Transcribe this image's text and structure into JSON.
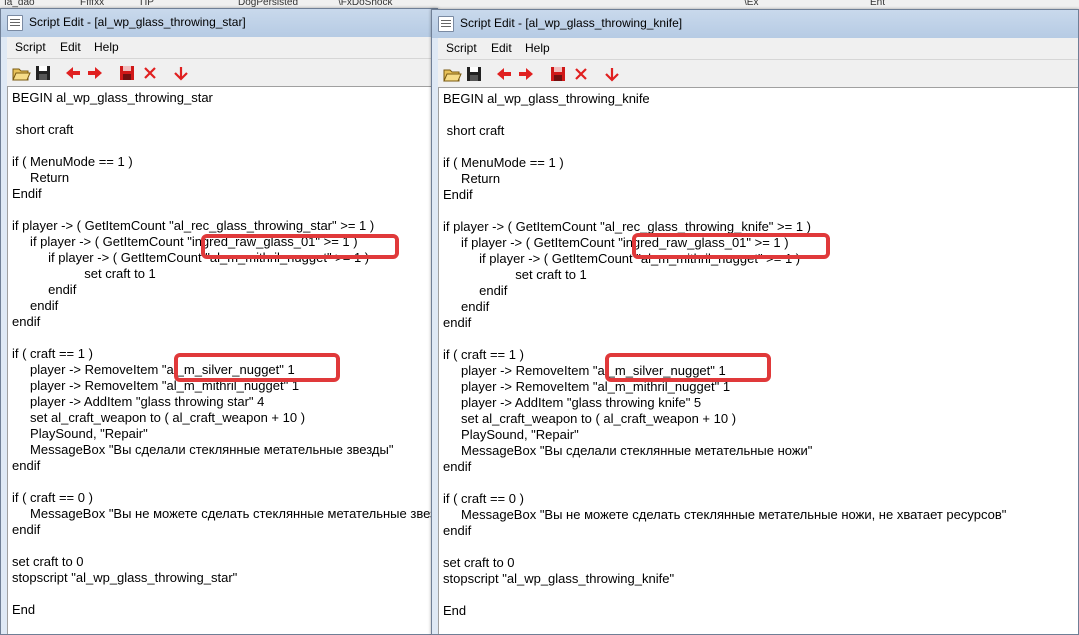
{
  "background": {
    "fragments": [
      "Ia_dao",
      "Ffffxx",
      "ПР",
      "DogPersisted",
      "\\FxDoShock",
      "\\Ex",
      "Ent"
    ]
  },
  "windows": [
    {
      "title": "Script Edit - [al_wp_glass_throwing_star]",
      "menu": [
        "Script",
        "Edit",
        "Help"
      ],
      "toolbar": [
        "open-folder-icon",
        "save-icon",
        "arrow-left-icon",
        "arrow-right-icon",
        "save-red-icon",
        "close-x-icon",
        "arrow-down-icon"
      ],
      "lines": [
        "BEGIN al_wp_glass_throwing_star",
        "",
        " short craft",
        "",
        "if ( MenuMode == 1 )",
        "     Return",
        "Endif",
        "",
        "if player -> ( GetItemCount \"al_rec_glass_throwing_star\" >= 1 )",
        "     if player -> ( GetItemCount \"ingred_raw_glass_01\" >= 1 )",
        "          if player -> ( GetItemCount \"al_m_mithril_nugget\" >= 1 )",
        "                    set craft to 1",
        "          endif",
        "     endif",
        "endif",
        "",
        "if ( craft == 1 )",
        "     player -> RemoveItem \"al_m_silver_nugget\" 1",
        "     player -> RemoveItem \"al_m_mithril_nugget\" 1",
        "     player -> AddItem \"glass throwing star\" 4",
        "     set al_craft_weapon to ( al_craft_weapon + 10 )",
        "     PlaySound, \"Repair\"",
        "     MessageBox \"Вы сделали стеклянные метательные звезды\"",
        "endif",
        "",
        "if ( craft == 0 )",
        "     MessageBox \"Вы не можете сделать стеклянные метательные звезды, не хватает ресурсов\"",
        "endif",
        "",
        "set craft to 0",
        "stopscript \"al_wp_glass_throwing_star\"",
        "",
        "End"
      ]
    },
    {
      "title": "Script Edit - [al_wp_glass_throwing_knife]",
      "menu": [
        "Script",
        "Edit",
        "Help"
      ],
      "toolbar": [
        "open-folder-icon",
        "save-icon",
        "arrow-left-icon",
        "arrow-right-icon",
        "save-red-icon",
        "close-x-icon",
        "arrow-down-icon"
      ],
      "lines": [
        "BEGIN al_wp_glass_throwing_knife",
        "",
        " short craft",
        "",
        "if ( MenuMode == 1 )",
        "     Return",
        "Endif",
        "",
        "if player -> ( GetItemCount \"al_rec_glass_throwing_knife\" >= 1 )",
        "     if player -> ( GetItemCount \"ingred_raw_glass_01\" >= 1 )",
        "          if player -> ( GetItemCount \"al_m_mithril_nugget\" >= 1 )",
        "                    set craft to 1",
        "          endif",
        "     endif",
        "endif",
        "",
        "if ( craft == 1 )",
        "     player -> RemoveItem \"al_m_silver_nugget\" 1",
        "     player -> RemoveItem \"al_m_mithril_nugget\" 1",
        "     player -> AddItem \"glass throwing knife\" 5",
        "     set al_craft_weapon to ( al_craft_weapon + 10 )",
        "     PlaySound, \"Repair\"",
        "     MessageBox \"Вы сделали стеклянные метательные ножи\"",
        "endif",
        "",
        "if ( craft == 0 )",
        "     MessageBox \"Вы не можете сделать стеклянные метательные ножи, не хватает ресурсов\"",
        "endif",
        "",
        "set craft to 0",
        "stopscript \"al_wp_glass_throwing_knife\"",
        "",
        "End"
      ]
    }
  ],
  "colors": {
    "highlight": "#e0393a",
    "arrow_red": "#e02020",
    "save_red": "#d01818"
  }
}
